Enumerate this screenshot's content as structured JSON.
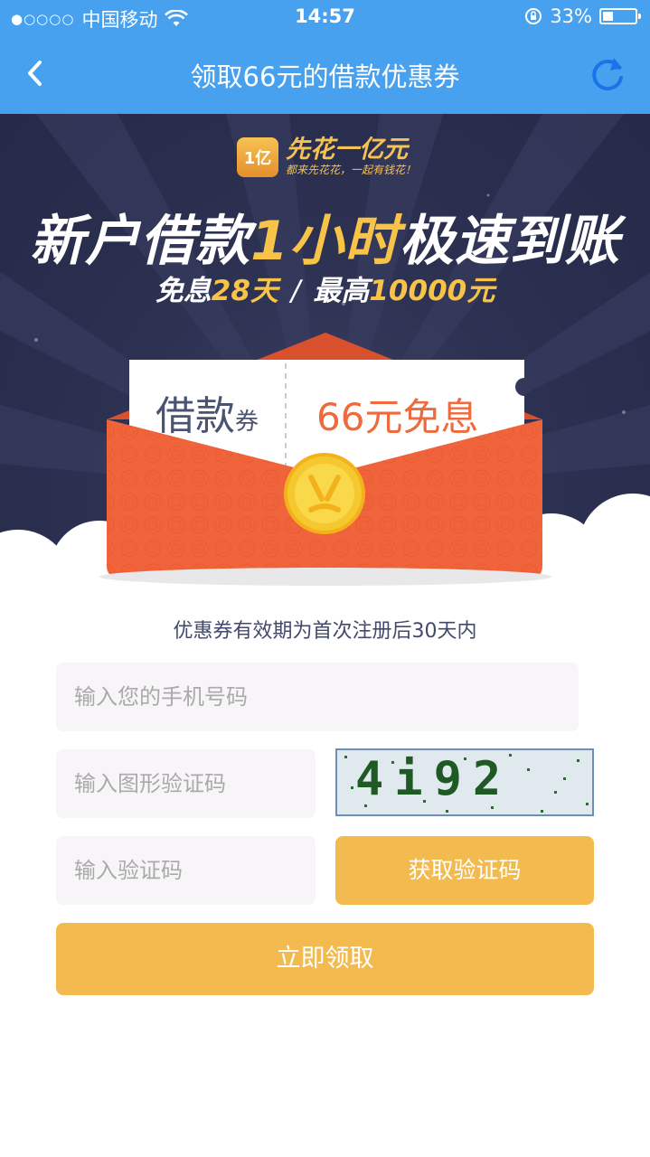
{
  "status": {
    "carrier": "中国移动",
    "time": "14:57",
    "battery": "33%",
    "battery_level": 0.33
  },
  "nav": {
    "title": "领取66元的借款优惠券"
  },
  "banner": {
    "logo_text": "1亿",
    "brand": "先花一亿元",
    "slogan": "都来先花花，一起有钱花！",
    "headline_a": "新户借款",
    "headline_b": "1小时",
    "headline_c": "极速到账",
    "sub_a": "免息",
    "sub_b": "28天",
    "sub_sep": "/",
    "sub_c": "最高",
    "sub_d": "10000元",
    "ticket_title": "借款",
    "ticket_unit": "券",
    "ticket_value": "66元免息"
  },
  "form": {
    "notice": "优惠券有效期为首次注册后30天内",
    "phone_placeholder": "输入您的手机号码",
    "captcha_placeholder": "输入图形验证码",
    "captcha_image_text": "4i92",
    "code_placeholder": "输入验证码",
    "get_code_label": "获取验证码",
    "submit_label": "立即领取"
  },
  "colors": {
    "nav_bg": "#47a1ee",
    "banner_bg": "#2d3152",
    "accent": "#f3bb4f",
    "envelope": "#f0643b"
  }
}
